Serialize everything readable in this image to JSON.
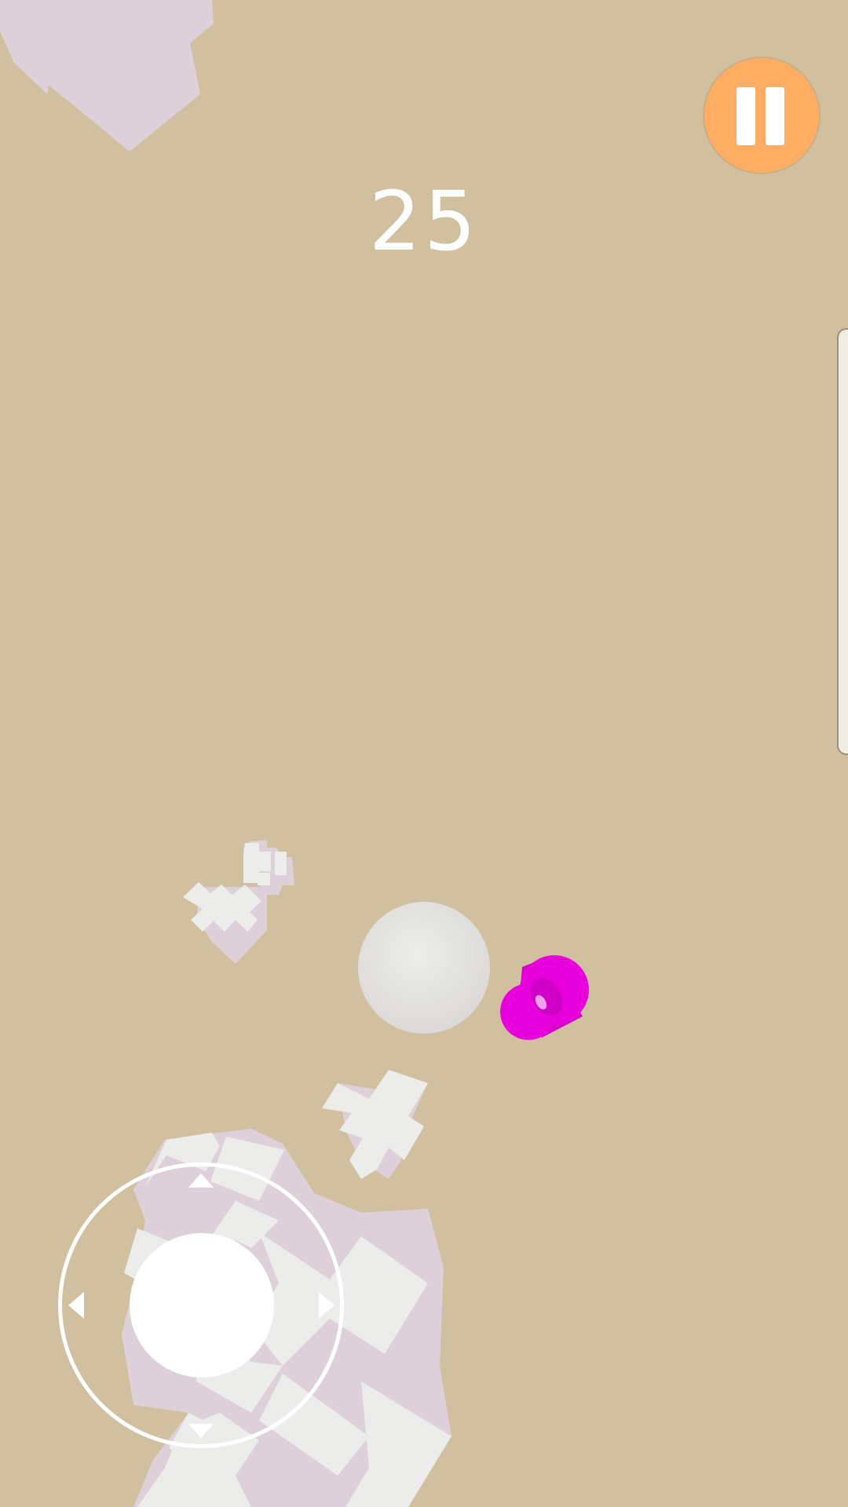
{
  "hud": {
    "score": "25"
  },
  "colors": {
    "background": "#d1c0a0",
    "pause_button": "#ffad62",
    "enemy": "#e800dc",
    "player": "#e4e2e0",
    "debris_light": "#ececea",
    "debris_shadow": "#ddd0d8"
  },
  "icons": {
    "pause": "pause-icon",
    "joystick_arrows": [
      "arrow-up-icon",
      "arrow-down-icon",
      "arrow-left-icon",
      "arrow-right-icon"
    ]
  }
}
